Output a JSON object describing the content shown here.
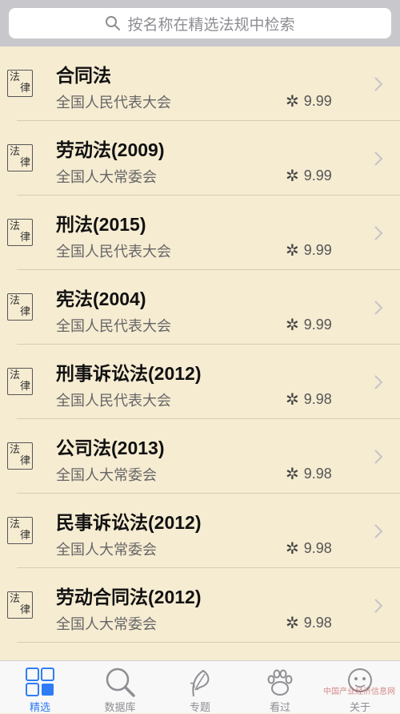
{
  "search": {
    "placeholder": "按名称在精选法规中检索"
  },
  "seal": {
    "char1": "法",
    "char2": "律"
  },
  "laws": [
    {
      "title": "合同法",
      "issuer": "全国人民代表大会",
      "rating": "9.99"
    },
    {
      "title": "劳动法(2009)",
      "issuer": "全国人大常委会",
      "rating": "9.99"
    },
    {
      "title": "刑法(2015)",
      "issuer": "全国人民代表大会",
      "rating": "9.99"
    },
    {
      "title": "宪法(2004)",
      "issuer": "全国人民代表大会",
      "rating": "9.99"
    },
    {
      "title": "刑事诉讼法(2012)",
      "issuer": "全国人民代表大会",
      "rating": "9.98"
    },
    {
      "title": "公司法(2013)",
      "issuer": "全国人大常委会",
      "rating": "9.98"
    },
    {
      "title": "民事诉讼法(2012)",
      "issuer": "全国人大常委会",
      "rating": "9.98"
    },
    {
      "title": "劳动合同法(2012)",
      "issuer": "全国人大常委会",
      "rating": "9.98"
    }
  ],
  "tabs": [
    {
      "label": "精选",
      "icon": "grid-icon",
      "active": true
    },
    {
      "label": "数据库",
      "icon": "magnifier-icon",
      "active": false
    },
    {
      "label": "专题",
      "icon": "leaf-icon",
      "active": false
    },
    {
      "label": "看过",
      "icon": "paw-icon",
      "active": false
    },
    {
      "label": "关于",
      "icon": "mascot-icon",
      "active": false
    }
  ],
  "watermark": "中国产业经济信息网",
  "colors": {
    "accent": "#2f7cf6",
    "background": "#f6ecd2"
  }
}
